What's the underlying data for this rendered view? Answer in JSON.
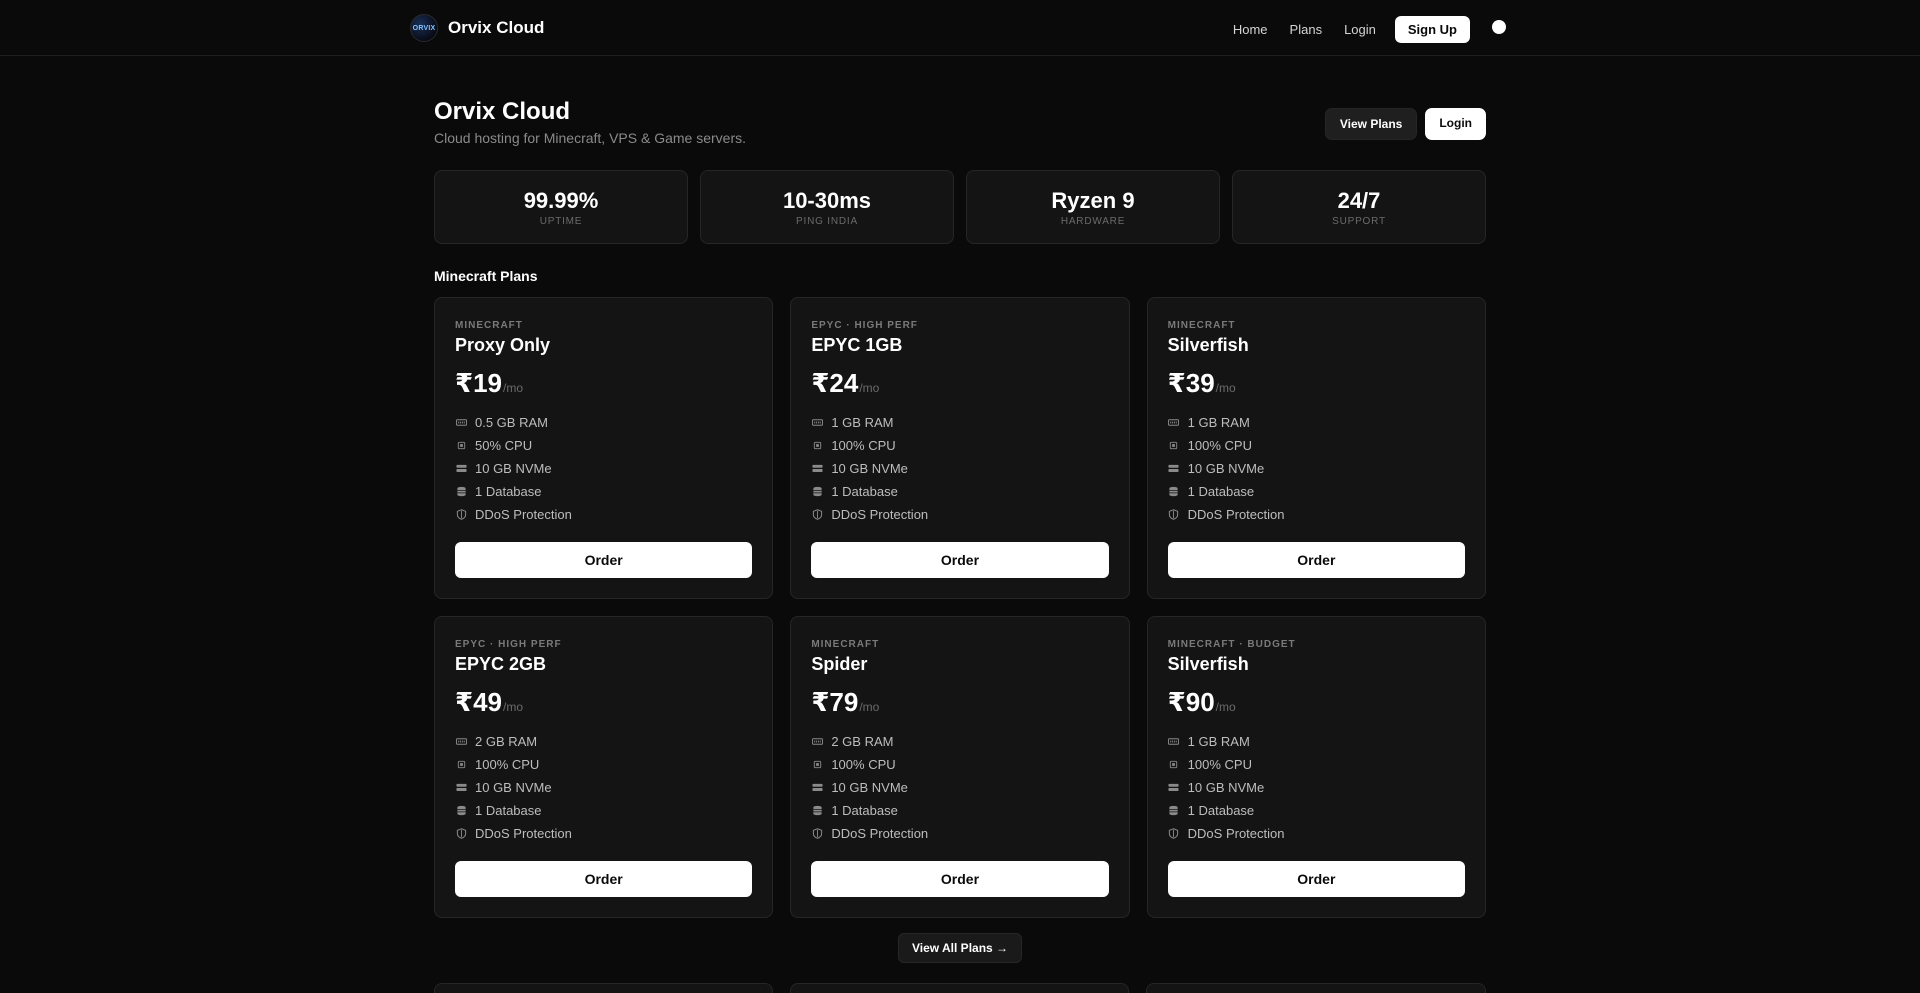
{
  "nav": {
    "logo_text": "ORVIX",
    "brand": "Orvix Cloud",
    "links": [
      "Home",
      "Plans",
      "Login"
    ],
    "signup": "Sign Up"
  },
  "hero": {
    "title": "Orvix Cloud",
    "subtitle": "Cloud hosting for Minecraft, VPS & Game servers.",
    "view_plans": "View Plans",
    "login": "Login"
  },
  "stats": [
    {
      "value": "99.99%",
      "label": "UPTIME"
    },
    {
      "value": "10-30ms",
      "label": "PING INDIA"
    },
    {
      "value": "Ryzen 9",
      "label": "HARDWARE"
    },
    {
      "value": "24/7",
      "label": "SUPPORT"
    }
  ],
  "section_title": "Minecraft Plans",
  "order_label": "Order",
  "price_unit": "/mo",
  "plans": [
    {
      "tag": "MINECRAFT",
      "name": "Proxy Only",
      "price": "₹19",
      "features": [
        "0.5 GB RAM",
        "50% CPU",
        "10 GB NVMe",
        "1 Database",
        "DDoS Protection"
      ]
    },
    {
      "tag": "EPYC · HIGH PERF",
      "name": "EPYC 1GB",
      "price": "₹24",
      "features": [
        "1 GB RAM",
        "100% CPU",
        "10 GB NVMe",
        "1 Database",
        "DDoS Protection"
      ]
    },
    {
      "tag": "MINECRAFT",
      "name": "Silverfish",
      "price": "₹39",
      "features": [
        "1 GB RAM",
        "100% CPU",
        "10 GB NVMe",
        "1 Database",
        "DDoS Protection"
      ]
    },
    {
      "tag": "EPYC · HIGH PERF",
      "name": "EPYC 2GB",
      "price": "₹49",
      "features": [
        "2 GB RAM",
        "100% CPU",
        "10 GB NVMe",
        "1 Database",
        "DDoS Protection"
      ]
    },
    {
      "tag": "MINECRAFT",
      "name": "Spider",
      "price": "₹79",
      "features": [
        "2 GB RAM",
        "100% CPU",
        "10 GB NVMe",
        "1 Database",
        "DDoS Protection"
      ]
    },
    {
      "tag": "MINECRAFT · BUDGET",
      "name": "Silverfish",
      "price": "₹90",
      "features": [
        "1 GB RAM",
        "100% CPU",
        "10 GB NVMe",
        "1 Database",
        "DDoS Protection"
      ]
    }
  ],
  "feature_icons": [
    "memory-icon",
    "cpu-icon",
    "storage-icon",
    "database-icon",
    "shield-icon"
  ],
  "view_all": "View All Plans →",
  "colors": {
    "background": "#0a0a0a",
    "card": "#141414",
    "border": "#262626",
    "accent": "#ffffff"
  }
}
